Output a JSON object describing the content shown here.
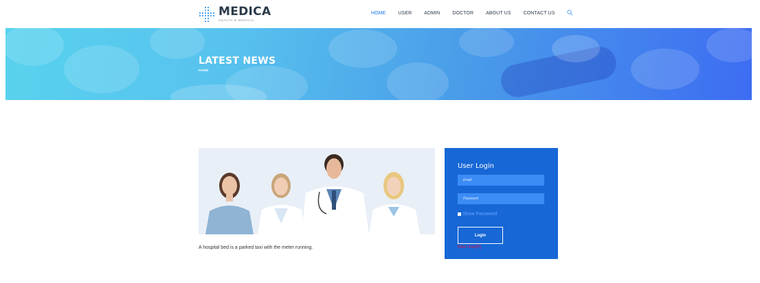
{
  "header": {
    "logo": {
      "title": "MEDICA",
      "subtitle": "HEALTH & MEDICAL"
    },
    "nav": [
      "HOME",
      "USER",
      "ADMIN",
      "DOCTOR",
      "ABOUT US",
      "CONTACT US"
    ],
    "active_nav": "HOME",
    "accent_color": "#1a73e8"
  },
  "banner": {
    "title": "LATEST NEWS",
    "breadcrumb": "HOME"
  },
  "content": {
    "caption": "A hospital bed is a parked taxi with the meter running."
  },
  "login": {
    "title": "User Login",
    "email_placeholder": "Email",
    "password_placeholder": "Password",
    "show_password_label": "Show Password",
    "button_label": "Login",
    "new_user_link": "New User(P)",
    "card_color": "#1767d6"
  }
}
